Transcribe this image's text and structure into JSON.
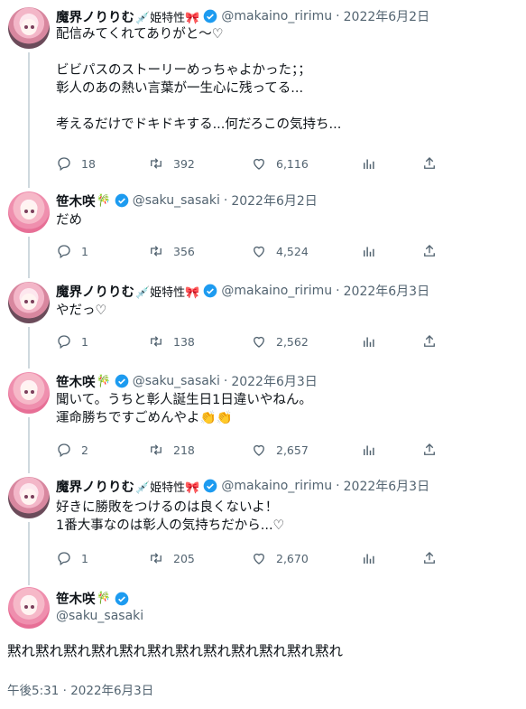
{
  "accent_color": "#1d9bf0",
  "tweets": [
    {
      "author": "魔界ノりりむ",
      "name_emoji": "💉姫特性🎀",
      "handle": "@makaino_ririmu",
      "date": "2022年6月2日",
      "text": "配信みてくれてありがと～♡\n\nビビパスのストーリーめっちゃよかった；；\n彰人のあの熱い言葉が一生心に残ってる...\n\n考えるだけでドキドキする...何だろこの気持ち...",
      "replies": "18",
      "retweets": "392",
      "likes": "6,116"
    },
    {
      "author": "笹木咲",
      "name_emoji": "🎋",
      "handle": "@saku_sasaki",
      "date": "2022年6月2日",
      "text": "だめ",
      "replies": "1",
      "retweets": "356",
      "likes": "4,524"
    },
    {
      "author": "魔界ノりりむ",
      "name_emoji": "💉姫特性🎀",
      "handle": "@makaino_ririmu",
      "date": "2022年6月3日",
      "text": "やだっ♡",
      "replies": "1",
      "retweets": "138",
      "likes": "2,562"
    },
    {
      "author": "笹木咲",
      "name_emoji": "🎋",
      "handle": "@saku_sasaki",
      "date": "2022年6月3日",
      "text": "聞いて。うちと彰人誕生日1日違いやねん。\n運命勝ちですごめんやよ👏👏",
      "replies": "2",
      "retweets": "218",
      "likes": "2,657"
    },
    {
      "author": "魔界ノりりむ",
      "name_emoji": "💉姫特性🎀",
      "handle": "@makaino_ririmu",
      "date": "2022年6月3日",
      "text": "好きに勝敗をつけるのは良くないよ！\n1番大事なのは彰人の気持ちだから...♡",
      "replies": "1",
      "retweets": "205",
      "likes": "2,670"
    }
  ],
  "focus": {
    "author": "笹木咲",
    "name_emoji": "🎋",
    "handle": "@saku_sasaki",
    "text": "黙れ黙れ黙れ黙れ黙れ黙れ黙れ黙れ黙れ黙れ黙れ黙れ",
    "timestamp": "午後5:31 · 2022年6月3日"
  }
}
